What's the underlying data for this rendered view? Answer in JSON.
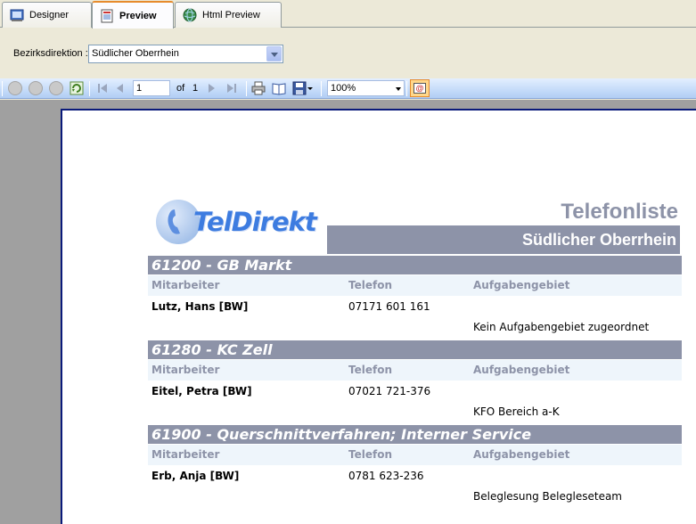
{
  "tabs": [
    {
      "label": "Designer",
      "icon": "designer-icon"
    },
    {
      "label": "Preview",
      "icon": "preview-icon",
      "active": true
    },
    {
      "label": "Html Preview",
      "icon": "globe-icon"
    }
  ],
  "parameter": {
    "label": "Bezirksdirektion :",
    "value": "Südlicher Oberrhein"
  },
  "toolbar": {
    "page_current": "1",
    "page_of_label": "of",
    "page_total": "1",
    "zoom": "100%",
    "mail_label": "@"
  },
  "report": {
    "logo_text": "TelDirekt",
    "title": "Telefonliste",
    "region": "Südlicher Oberrhein",
    "columns": [
      "Mitarbeiter",
      "Telefon",
      "Aufgabengebiet"
    ],
    "groups": [
      {
        "heading": "61200 - GB Markt",
        "employee": "Lutz,  Hans [BW]",
        "phone": "07171 601 161",
        "task": "Kein Aufgabengebiet zugeordnet"
      },
      {
        "heading": "61280 - KC Zell",
        "employee": "Eitel,  Petra [BW]",
        "phone": "07021 721-376",
        "task": "KFO Bereich a-K"
      },
      {
        "heading": "61900 - Querschnittverfahren; Interner Service",
        "employee": "Erb,  Anja [BW]",
        "phone": "0781 623-236",
        "task": "Beleglesung Belegleseteam"
      }
    ]
  },
  "colors": {
    "accent_bar": "#8d93a8",
    "column_header_bg": "#eef5fb",
    "logo_blue": "#3d7ce0",
    "active_tab_accent": "#e68b2c"
  }
}
